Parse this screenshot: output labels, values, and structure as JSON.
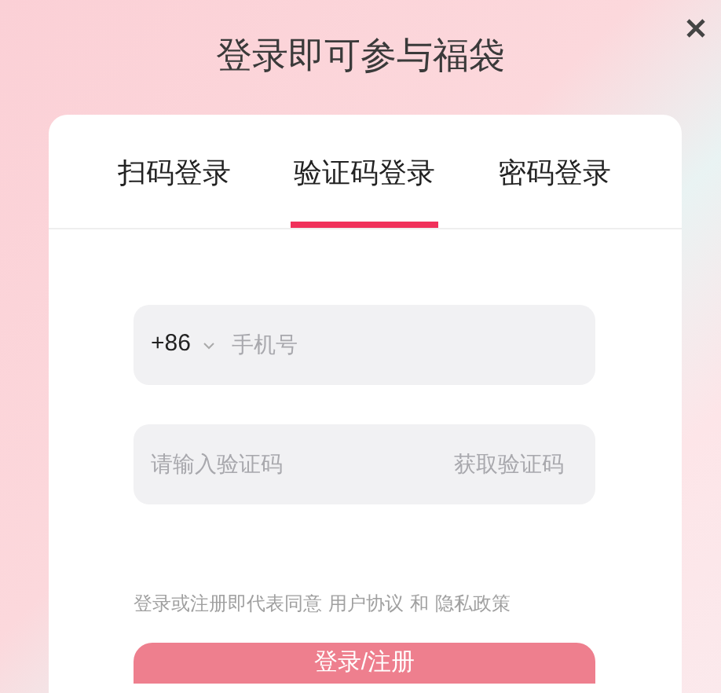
{
  "title": "登录即可参与福袋",
  "tabs": [
    {
      "label": "扫码登录",
      "selected": false
    },
    {
      "label": "验证码登录",
      "selected": true
    },
    {
      "label": "密码登录",
      "selected": false
    }
  ],
  "phone_field": {
    "country_code": "+86",
    "placeholder": "手机号"
  },
  "code_field": {
    "placeholder": "请输入验证码",
    "action": "获取验证码"
  },
  "agreement": {
    "text": "登录或注册即代表同意",
    "links": [
      "用户协议",
      "隐私政策"
    ],
    "joiner": "和"
  },
  "submit_button": {
    "label": "登录/注册",
    "disabled": true
  }
}
